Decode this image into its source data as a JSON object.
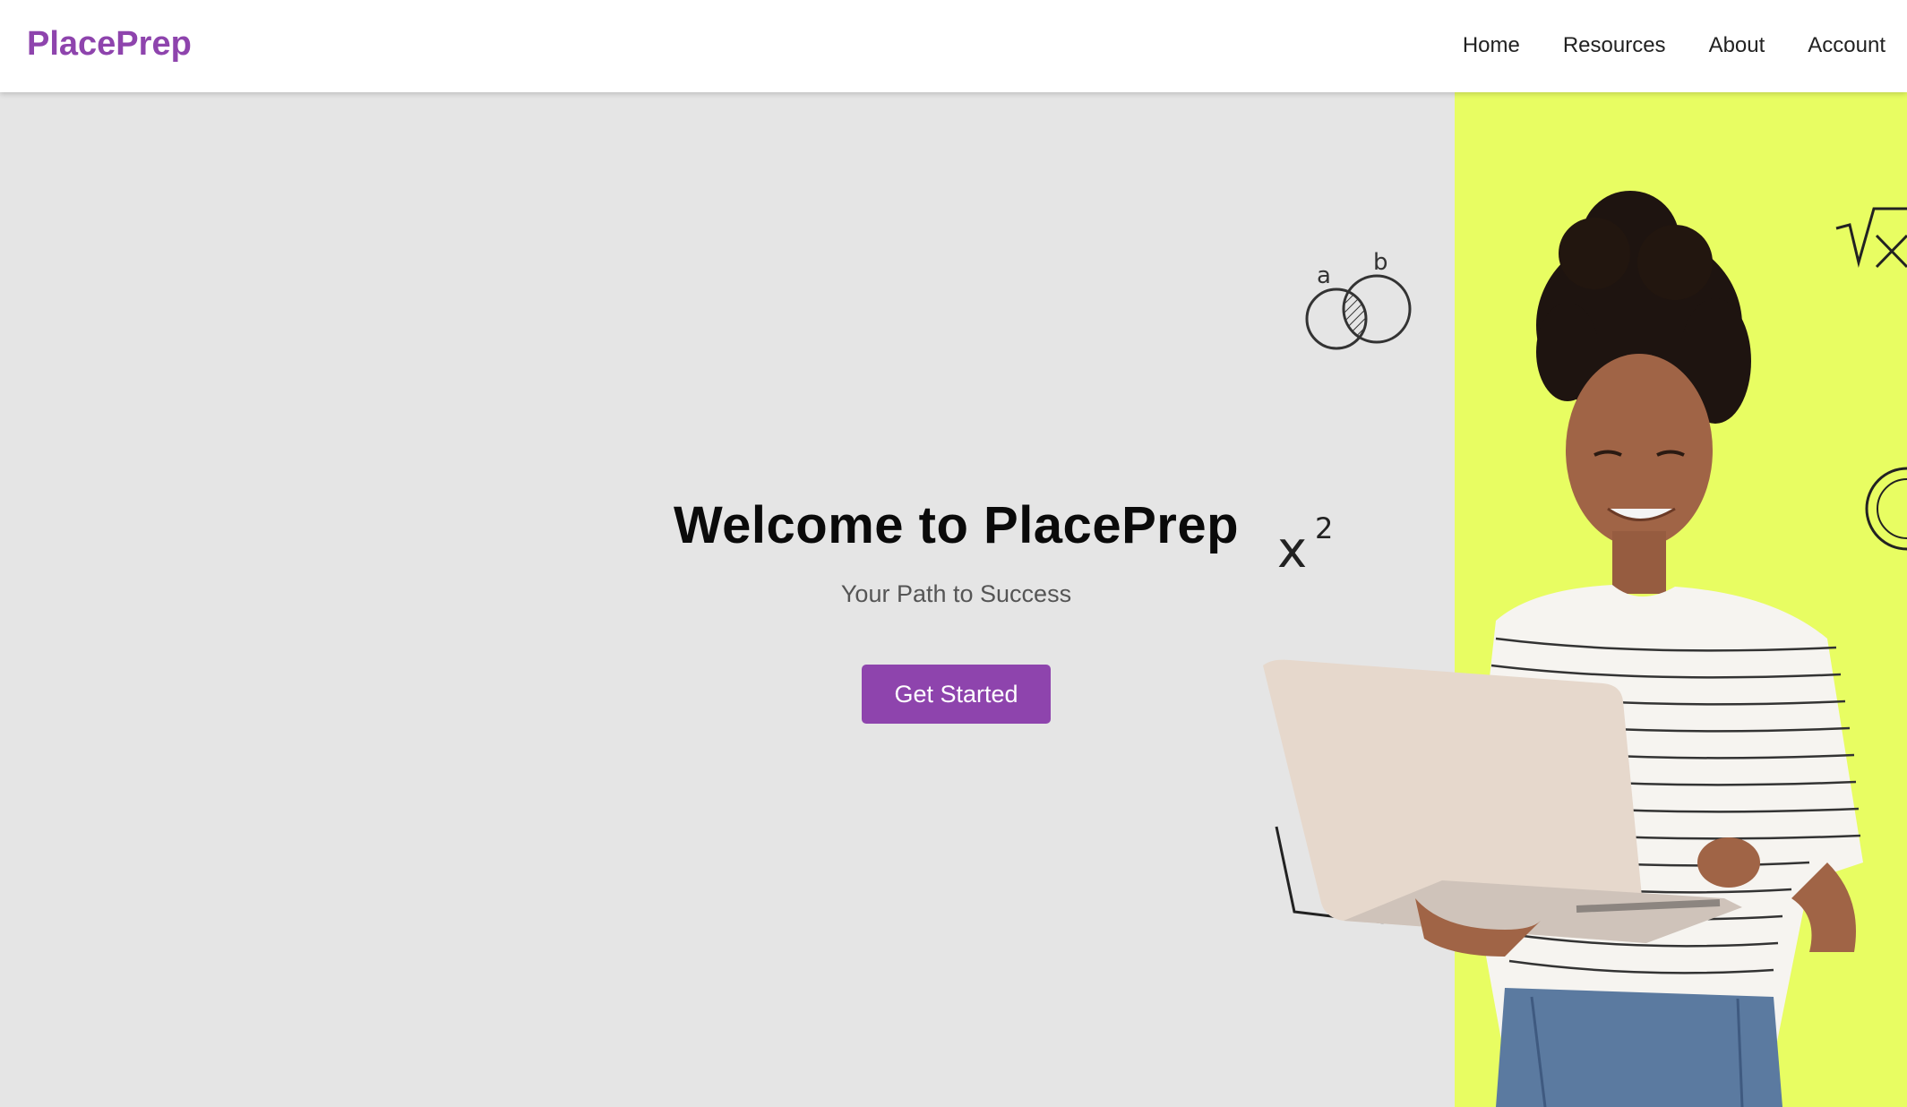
{
  "brand": {
    "name": "PlacePrep",
    "color": "#8e44ad"
  },
  "nav": {
    "items": [
      {
        "label": "Home"
      },
      {
        "label": "Resources"
      },
      {
        "label": "About"
      },
      {
        "label": "Account"
      }
    ]
  },
  "hero": {
    "title": "Welcome to PlacePrep",
    "subtitle": "Your Path to Success",
    "cta_label": "Get Started",
    "accent_color": "#e8fd62",
    "background_color": "#e5e5e5"
  },
  "doodles": {
    "venn_left_label": "a",
    "venn_right_label": "b",
    "power": "x",
    "power_exp": "2"
  }
}
